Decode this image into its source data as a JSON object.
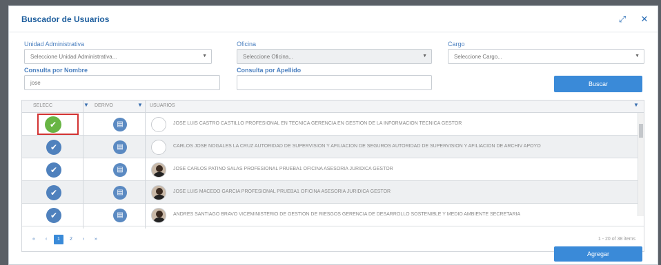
{
  "modal": {
    "title": "Buscador de Usuarios",
    "expand_icon": "expand-icon",
    "close_icon": "close-icon"
  },
  "filters": {
    "unidad_label": "Unidad Administrativa",
    "unidad_value": "Seleccione Unidad Administrativa...",
    "oficina_label": "Oficina",
    "oficina_value": "Seleccione Oficina...",
    "cargo_label": "Cargo",
    "cargo_value": "Seleccione Cargo...",
    "nombre_label": "Consulta por Nombre",
    "nombre_value": "jose",
    "apellido_label": "Consulta por Apellido",
    "apellido_value": "",
    "search_button": "Buscar"
  },
  "grid": {
    "columns": [
      "SELECC",
      "DERIVO",
      "USUARIOS"
    ],
    "rows": [
      {
        "text": "JOSE LUIS CASTRO CASTILLO     PROFESIONAL EN TECNICA     GERENCIA EN GESTION DE LA INFORMACION TECNICA     GESTOR",
        "avatar": "empty",
        "selected": true
      },
      {
        "text": "CARLOS JOSE NOGALES LA CRUZ     AUTORIDAD DE SUPERVISION Y AFILIACION DE SEGUROS     AUTORIDAD DE SUPERVISION Y AFILIACION DE ARCHIV     APOYO",
        "avatar": "empty",
        "selected": false
      },
      {
        "text": "JOSE CARLOS PATIÑO SALAS     PROFESIONAL PRUEBA1     OFICINA ASESORIA JURIDICA     GESTOR",
        "avatar": "photo",
        "selected": false
      },
      {
        "text": "JOSE LUIS MACEDO GARCIA     PROFESIONAL PRUEBA1     OFICINA ASESORIA JURIDICA     GESTOR",
        "avatar": "photo",
        "selected": false
      },
      {
        "text": "ANDRES SANTIAGO BRAVO     VICEMINISTERIO DE GESTION DE RIESGOS     GERENCIA DE DESARROLLO SOSTENIBLE Y MEDIO AMBIENTE     SECRETARIA",
        "avatar": "photo",
        "selected": false
      }
    ],
    "pager": {
      "first": "«",
      "prev": "‹",
      "page1": "1",
      "page2": "2",
      "next": "›",
      "last": "»",
      "info": "1 - 20 of 38 items"
    }
  },
  "footer": {
    "add_button": "Agregar"
  },
  "colors": {
    "accent": "#3a8ad8",
    "title": "#1f5f9e",
    "selected": "#68b544",
    "highlight": "#d23232"
  }
}
